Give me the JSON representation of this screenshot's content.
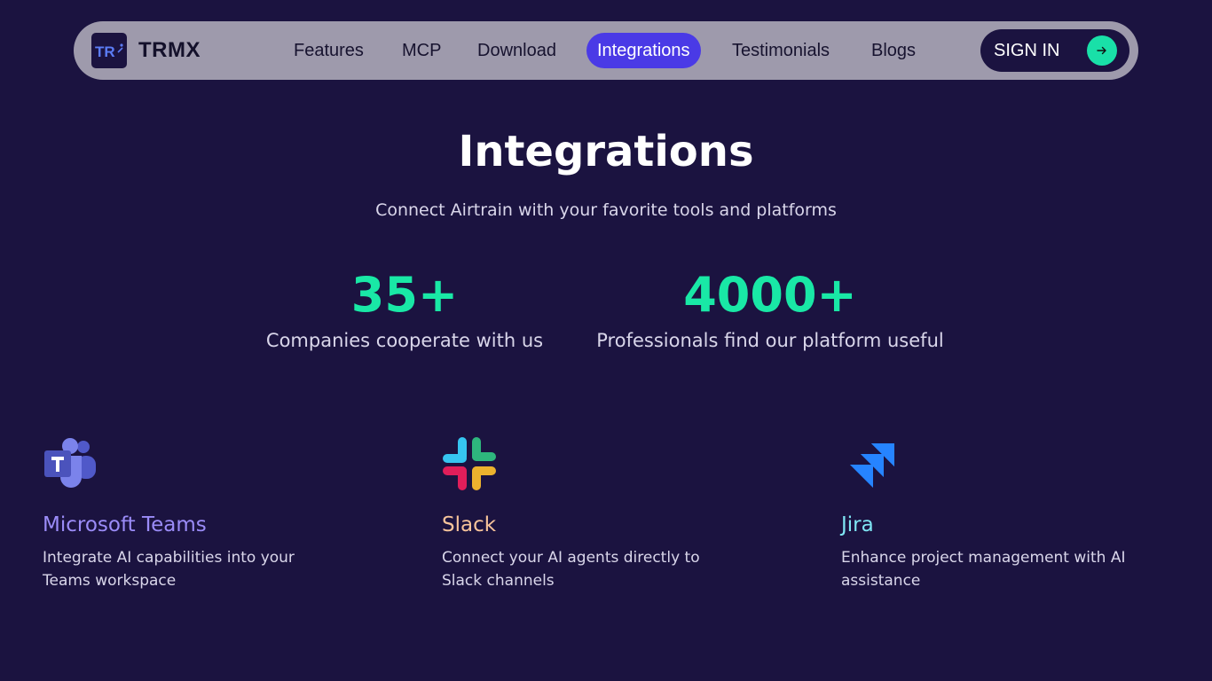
{
  "nav": {
    "logo_mark": "TR",
    "brand": "TRMX",
    "items": [
      {
        "label": "Features"
      },
      {
        "label": "MCP"
      },
      {
        "label": "Download"
      },
      {
        "label": "Integrations",
        "active": true
      },
      {
        "label": "Testimonials"
      },
      {
        "label": "Blogs"
      }
    ],
    "signin_label": "SIGN IN",
    "signin_icon": "arrow-right-icon"
  },
  "hero": {
    "title": "Integrations",
    "subtitle": "Connect Airtrain with your favorite tools and platforms"
  },
  "stats": [
    {
      "value": "35+",
      "label": "Companies cooperate with us"
    },
    {
      "value": "4000+",
      "label": "Professionals find our platform useful"
    }
  ],
  "integrations": [
    {
      "name": "Microsoft Teams",
      "description": "Integrate AI capabilities into your Teams workspace",
      "icon": "microsoft-teams-icon",
      "color": "#9b8cf8"
    },
    {
      "name": "Slack",
      "description": "Connect your AI agents directly to Slack channels",
      "icon": "slack-icon",
      "color": "#f7c49b"
    },
    {
      "name": "Jira",
      "description": "Enhance project management with AI assistance",
      "icon": "jira-icon",
      "color": "#7fe6f4"
    }
  ],
  "colors": {
    "background": "#1b1340",
    "accent": "#4a3ae6",
    "stat": "#19e8a6",
    "nav_bg": "#9e9aac"
  }
}
